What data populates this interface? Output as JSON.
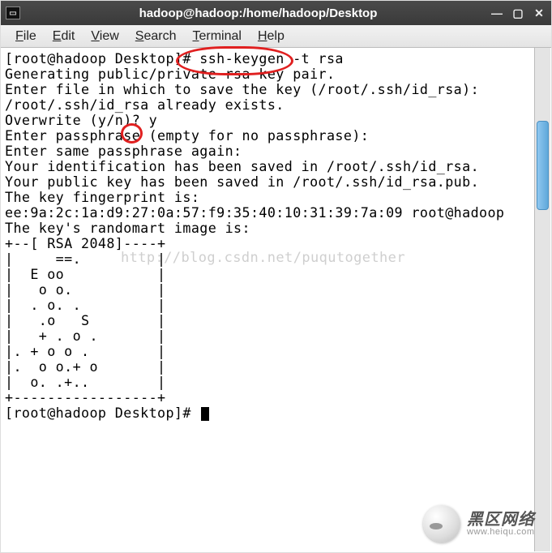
{
  "window": {
    "title": "hadoop@hadoop:/home/hadoop/Desktop"
  },
  "menubar": {
    "file": "File",
    "edit": "Edit",
    "view": "View",
    "search": "Search",
    "terminal": "Terminal",
    "help": "Help"
  },
  "term": {
    "l01": "[root@hadoop Desktop]# ssh-keygen -t rsa",
    "l02": "Generating public/private rsa key pair.",
    "l03": "Enter file in which to save the key (/root/.ssh/id_rsa):",
    "l04": "/root/.ssh/id_rsa already exists.",
    "l05": "Overwrite (y/n)? y",
    "l06": "Enter passphrase (empty for no passphrase):",
    "l07": "Enter same passphrase again:",
    "l08": "Your identification has been saved in /root/.ssh/id_rsa.",
    "l09": "Your public key has been saved in /root/.ssh/id_rsa.pub.",
    "l10": "The key fingerprint is:",
    "l11": "ee:9a:2c:1a:d9:27:0a:57:f9:35:40:10:31:39:7a:09 root@hadoop",
    "l12": "The key's randomart image is:",
    "l13": "+--[ RSA 2048]----+",
    "l14": "|     ==.         |",
    "l15": "|  E oo           |",
    "l16": "|   o o.          |",
    "l17": "|  . o. .         |",
    "l18": "|   .o   S        |",
    "l19": "|   + . o .       |",
    "l20": "|. + o o .        |",
    "l21": "|.  o o.+ o       |",
    "l22": "|  o. .+..        |",
    "l23": "+-----------------+",
    "l24": "[root@hadoop Desktop]# "
  },
  "watermark_blog": "http://blog.csdn.net/puqutogether",
  "brand": {
    "cn": "黑区网络",
    "en": "www.heiqu.com"
  }
}
